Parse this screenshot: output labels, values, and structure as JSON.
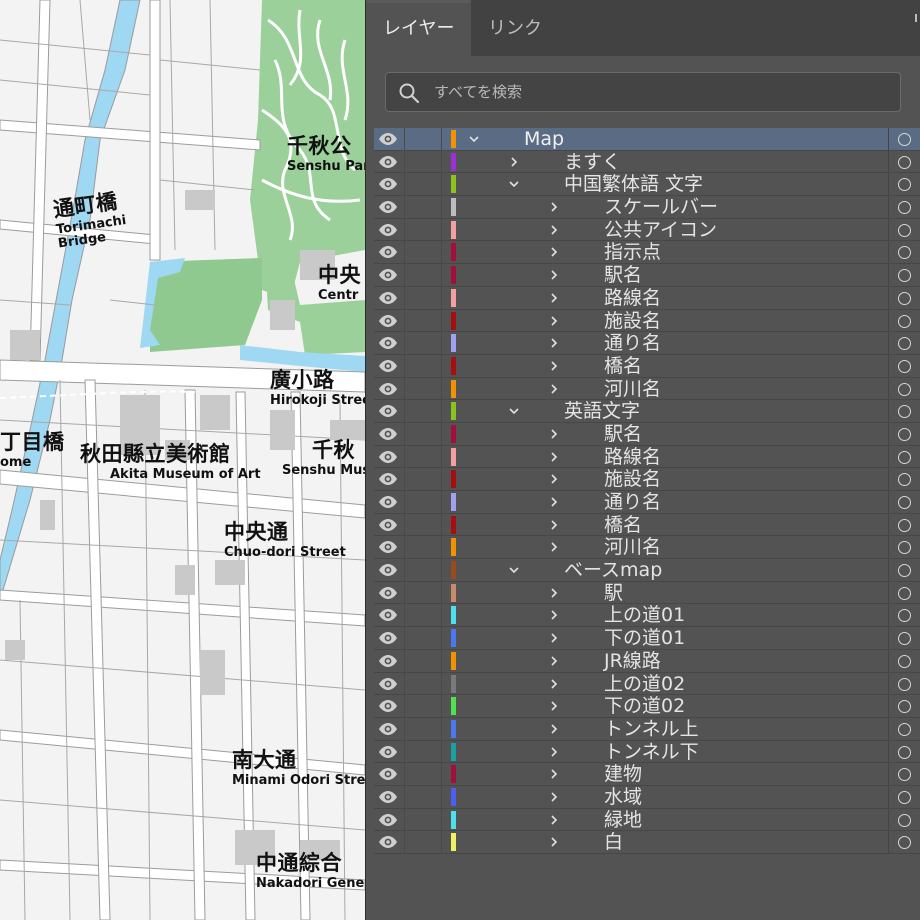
{
  "map": {
    "labels": {
      "senshu_park": {
        "jp": "千秋公",
        "en": "Senshu Par"
      },
      "torimachi_bridge": {
        "jp": "通町橋",
        "en": "Torimachi",
        "en2": "Bridge"
      },
      "central": {
        "jp": "中央",
        "en": "Centr"
      },
      "hirokoji": {
        "jp": "廣小路",
        "en": "Hirokoji Stree"
      },
      "chome_bridge": {
        "jp": "丁目橋",
        "en": "ome"
      },
      "akita_museum": {
        "jp": "秋田縣立美術館",
        "en": "Akita Museum of Art"
      },
      "senshu_museum": {
        "jp": "千秋",
        "en": "Senshu Mus"
      },
      "chuo_dori": {
        "jp": "中央通",
        "en": "Chuo-dori Street"
      },
      "minami_odori": {
        "jp": "南大通",
        "en": "Minami Odori Stre"
      },
      "nakadori": {
        "jp": "中通綜合",
        "en": "Nakadori Gene"
      }
    },
    "colors": {
      "road": "#ffffff",
      "block": "#f2f2f2",
      "building": "#c8c8c8",
      "park": "#8fc98f",
      "water": "#9fd8f2",
      "outline": "#9a9a9a"
    }
  },
  "panel": {
    "tabs": [
      {
        "label": "レイヤー",
        "active": true
      },
      {
        "label": "リンク",
        "active": false
      }
    ],
    "search": {
      "placeholder": "すべてを検索",
      "value": ""
    },
    "layers": [
      {
        "name": "Map",
        "depth": 0,
        "expanded": true,
        "color": "#f39200",
        "selected": true
      },
      {
        "name": "ますく",
        "depth": 1,
        "expanded": false,
        "color": "#9b30d9"
      },
      {
        "name": "中国繁体語 文字",
        "depth": 1,
        "expanded": true,
        "color": "#8cc21c"
      },
      {
        "name": "スケールバー",
        "depth": 2,
        "expanded": false,
        "color": "#bdbdbd"
      },
      {
        "name": "公共アイコン",
        "depth": 2,
        "expanded": false,
        "color": "#f2a0a0"
      },
      {
        "name": "指示点",
        "depth": 2,
        "expanded": false,
        "color": "#a0103a"
      },
      {
        "name": "駅名",
        "depth": 2,
        "expanded": false,
        "color": "#a0103a"
      },
      {
        "name": "路線名",
        "depth": 2,
        "expanded": false,
        "color": "#f2a0a0"
      },
      {
        "name": "施設名",
        "depth": 2,
        "expanded": false,
        "color": "#a50f0f"
      },
      {
        "name": "通り名",
        "depth": 2,
        "expanded": false,
        "color": "#a0a0f0"
      },
      {
        "name": "橋名",
        "depth": 2,
        "expanded": false,
        "color": "#a50f0f"
      },
      {
        "name": "河川名",
        "depth": 2,
        "expanded": false,
        "color": "#f39200"
      },
      {
        "name": "英語文字",
        "depth": 1,
        "expanded": true,
        "color": "#8cc21c"
      },
      {
        "name": "駅名",
        "depth": 2,
        "expanded": false,
        "color": "#a0103a"
      },
      {
        "name": "路線名",
        "depth": 2,
        "expanded": false,
        "color": "#f2a0a0"
      },
      {
        "name": "施設名",
        "depth": 2,
        "expanded": false,
        "color": "#a50f0f"
      },
      {
        "name": "通り名",
        "depth": 2,
        "expanded": false,
        "color": "#a0a0f0"
      },
      {
        "name": "橋名",
        "depth": 2,
        "expanded": false,
        "color": "#a50f0f"
      },
      {
        "name": "河川名",
        "depth": 2,
        "expanded": false,
        "color": "#f39200"
      },
      {
        "name": "ベースmap",
        "depth": 1,
        "expanded": true,
        "color": "#9a4b1c"
      },
      {
        "name": "駅",
        "depth": 2,
        "expanded": false,
        "color": "#c98a6a"
      },
      {
        "name": "上の道01",
        "depth": 2,
        "expanded": false,
        "color": "#4fe0f0"
      },
      {
        "name": "下の道01",
        "depth": 2,
        "expanded": false,
        "color": "#4a78f0"
      },
      {
        "name": "JR線路",
        "depth": 2,
        "expanded": false,
        "color": "#f39200"
      },
      {
        "name": "上の道02",
        "depth": 2,
        "expanded": false,
        "color": "#7a7a7a"
      },
      {
        "name": "下の道02",
        "depth": 2,
        "expanded": false,
        "color": "#50e050"
      },
      {
        "name": "トンネル上",
        "depth": 2,
        "expanded": false,
        "color": "#4a78f0"
      },
      {
        "name": "トンネル下",
        "depth": 2,
        "expanded": false,
        "color": "#1aa0a0"
      },
      {
        "name": "建物",
        "depth": 2,
        "expanded": false,
        "color": "#a0103a"
      },
      {
        "name": "水域",
        "depth": 2,
        "expanded": false,
        "color": "#4a60f0"
      },
      {
        "name": "緑地",
        "depth": 2,
        "expanded": false,
        "color": "#4fe0f0"
      },
      {
        "name": "白",
        "depth": 2,
        "expanded": false,
        "color": "#f0f060"
      }
    ]
  }
}
